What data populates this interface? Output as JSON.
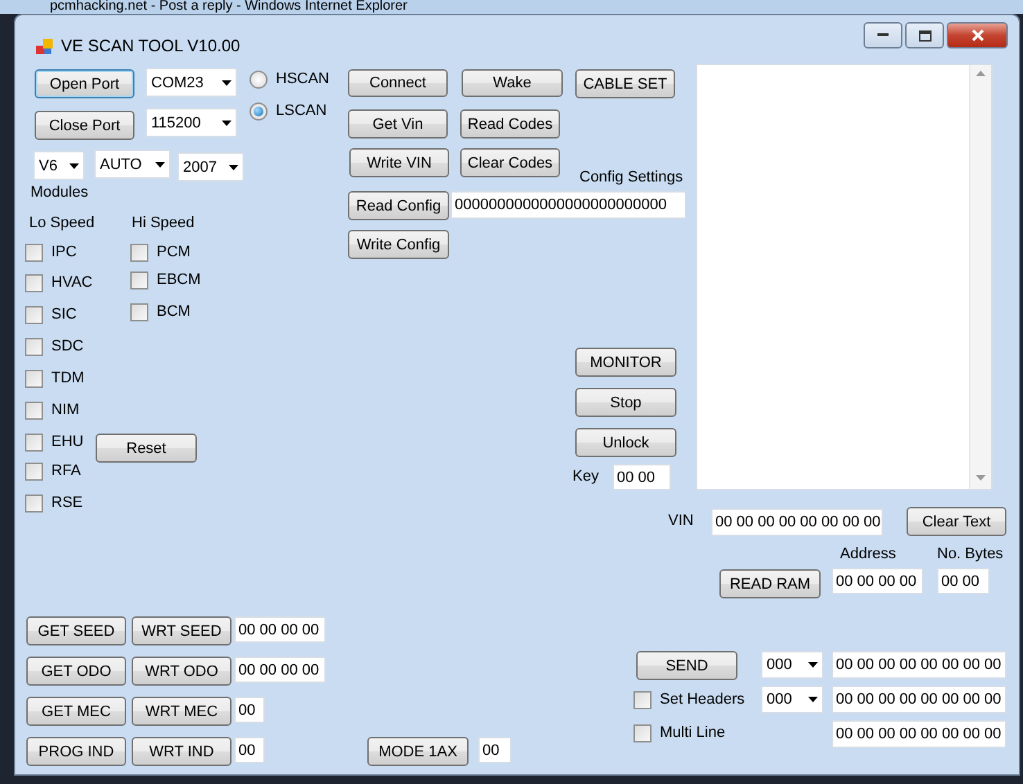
{
  "background_window": {
    "title": "pcmhacking.net - Post a reply - Windows Internet Explorer"
  },
  "window": {
    "title": "VE SCAN TOOL V10.00"
  },
  "port": {
    "open_button": {
      "label": "Open Port",
      "focused": true
    },
    "close_button": {
      "label": "Close Port",
      "focused": false
    },
    "port_select": "COM23",
    "baud_select": "115200"
  },
  "vehicle": {
    "engine_select": "V6",
    "trans_select": "AUTO",
    "year_select": "2007"
  },
  "bus": [
    {
      "label": "HSCAN",
      "selected": false
    },
    {
      "label": "LSCAN",
      "selected": true
    }
  ],
  "modules": {
    "title": "Modules",
    "lo_speed": {
      "title": "Lo Speed",
      "items": [
        {
          "label": "IPC",
          "checked": false
        },
        {
          "label": "HVAC",
          "checked": false
        },
        {
          "label": "SIC",
          "checked": false
        },
        {
          "label": "SDC",
          "checked": false
        },
        {
          "label": "TDM",
          "checked": false
        },
        {
          "label": "NIM",
          "checked": false
        },
        {
          "label": "EHU",
          "checked": false
        },
        {
          "label": "RFA",
          "checked": false
        },
        {
          "label": "RSE",
          "checked": false
        }
      ]
    },
    "hi_speed": {
      "title": "Hi Speed",
      "items": [
        {
          "label": "PCM",
          "checked": false
        },
        {
          "label": "EBCM",
          "checked": false
        },
        {
          "label": "BCM",
          "checked": false
        }
      ]
    },
    "reset_button": "Reset"
  },
  "commands": [
    "Connect",
    "Wake",
    "CABLE SET",
    "Get Vin",
    "Read Codes",
    "Write VIN",
    "Clear Codes"
  ],
  "config": {
    "label": "Config Settings",
    "read_button": "Read Config",
    "value": "0000000000000000000000000",
    "write_button": "Write Config"
  },
  "monitor_buttons": [
    "MONITOR",
    "Stop",
    "Unlock"
  ],
  "key": {
    "label": "Key",
    "value": "00 00"
  },
  "vin": {
    "label": "VIN",
    "value": "00 00 00 00 00 00 00 00",
    "clear_button": "Clear Text"
  },
  "ram": {
    "address_label": "Address",
    "bytes_label": "No. Bytes",
    "read_button": "READ RAM",
    "address": "00 00 00 00",
    "bytes": "00 00"
  },
  "seed_rows": [
    {
      "get_button": "GET SEED",
      "write_button": "WRT SEED",
      "value": "00 00 00 00"
    },
    {
      "get_button": "GET ODO",
      "write_button": "WRT ODO",
      "value": "00 00 00 00"
    },
    {
      "get_button": "GET MEC",
      "write_button": "WRT MEC",
      "value": "00"
    },
    {
      "get_button": "PROG IND",
      "write_button": "WRT IND",
      "value": "00"
    }
  ],
  "mode": {
    "button": "MODE 1AX",
    "value": "00"
  },
  "send": {
    "button": "SEND",
    "select": "000",
    "data": "00 00 00 00 00 00 00 00"
  },
  "send_options": [
    {
      "label": "Set Headers",
      "checked": false,
      "select": "000",
      "data": "00 00 00 00 00 00 00 00"
    },
    {
      "label": "Multi Line",
      "checked": false,
      "data": "00 00 00 00 00 00 00 00"
    }
  ]
}
